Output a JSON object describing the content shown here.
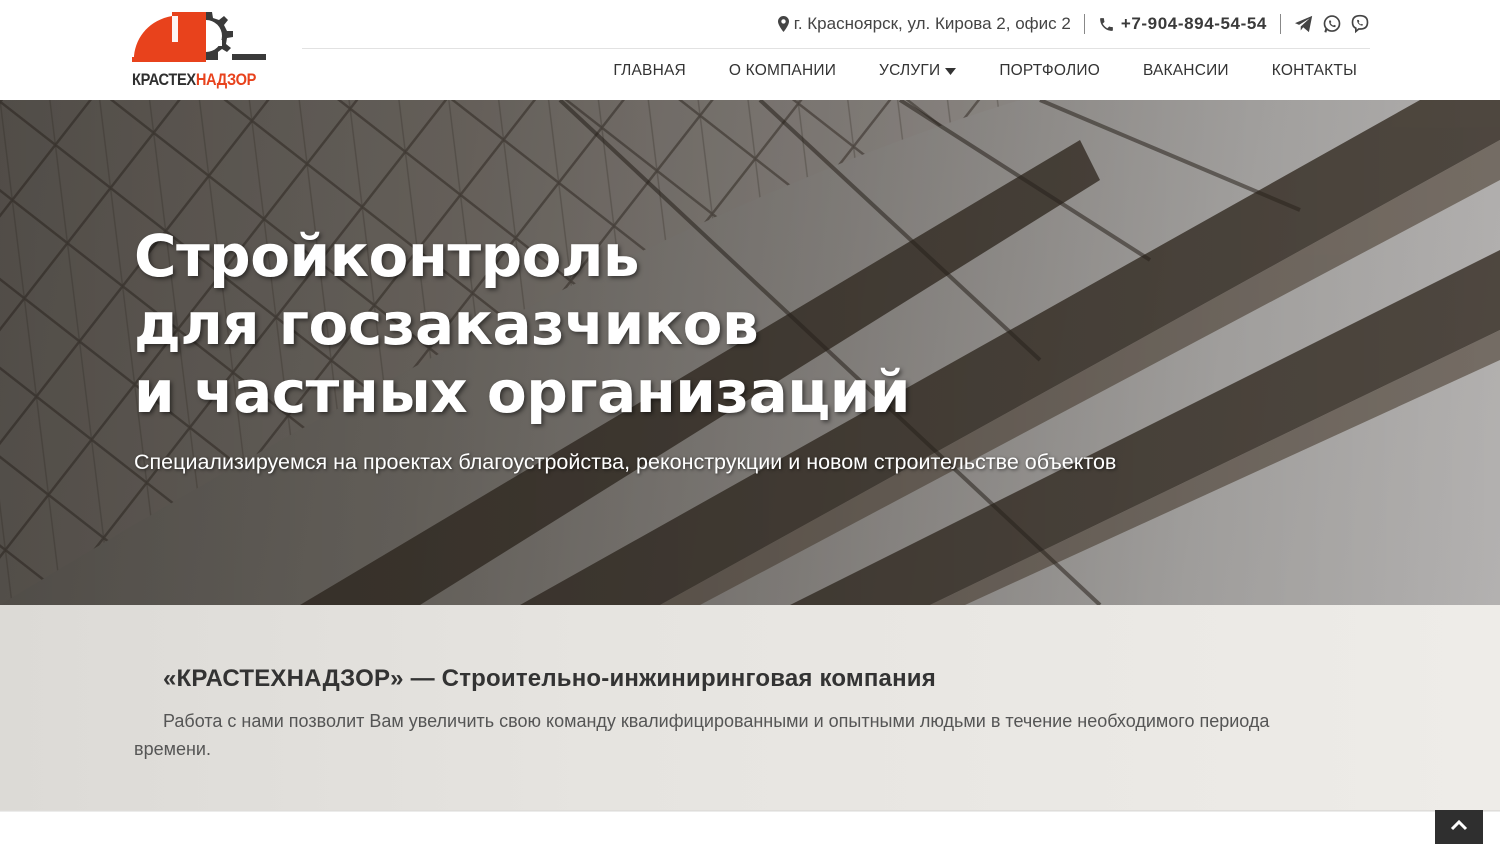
{
  "brand": {
    "name_part1": "КРАСТЕХ",
    "name_part2": "НАДЗОР",
    "dark_color": "#2f2f2f",
    "accent_color": "#e8421c"
  },
  "contacts": {
    "address": "г. Красноярск, ул. Кирова 2, офис 2",
    "phone": "+7-904-894-54-54",
    "icons": [
      "map-marker-icon",
      "phone-icon",
      "telegram-icon",
      "whatsapp-icon",
      "viber-icon"
    ]
  },
  "nav": {
    "items": [
      {
        "label": "ГЛАВНАЯ"
      },
      {
        "label": "О КОМПАНИИ"
      },
      {
        "label": "УСЛУГИ",
        "has_dropdown": true
      },
      {
        "label": "ПОРТФОЛИО"
      },
      {
        "label": "ВАКАНСИИ"
      },
      {
        "label": "КОНТАКТЫ"
      }
    ]
  },
  "hero": {
    "title_lines": [
      "Стройконтроль",
      "для госзаказчиков",
      "и частных организаций"
    ],
    "subtitle": "Специализируемся на проектах благоустройства, реконструкции и новом строительстве объектов"
  },
  "about": {
    "title": "«КРАСТЕХНАДЗОР» — Строительно-инжиниринговая компания",
    "text": "Работа с нами позволит Вам увеличить свою команду квалифицированными и опытными людьми в течение необходимого периода времени."
  },
  "scroll_top": {
    "icon": "chevron-up-icon"
  }
}
